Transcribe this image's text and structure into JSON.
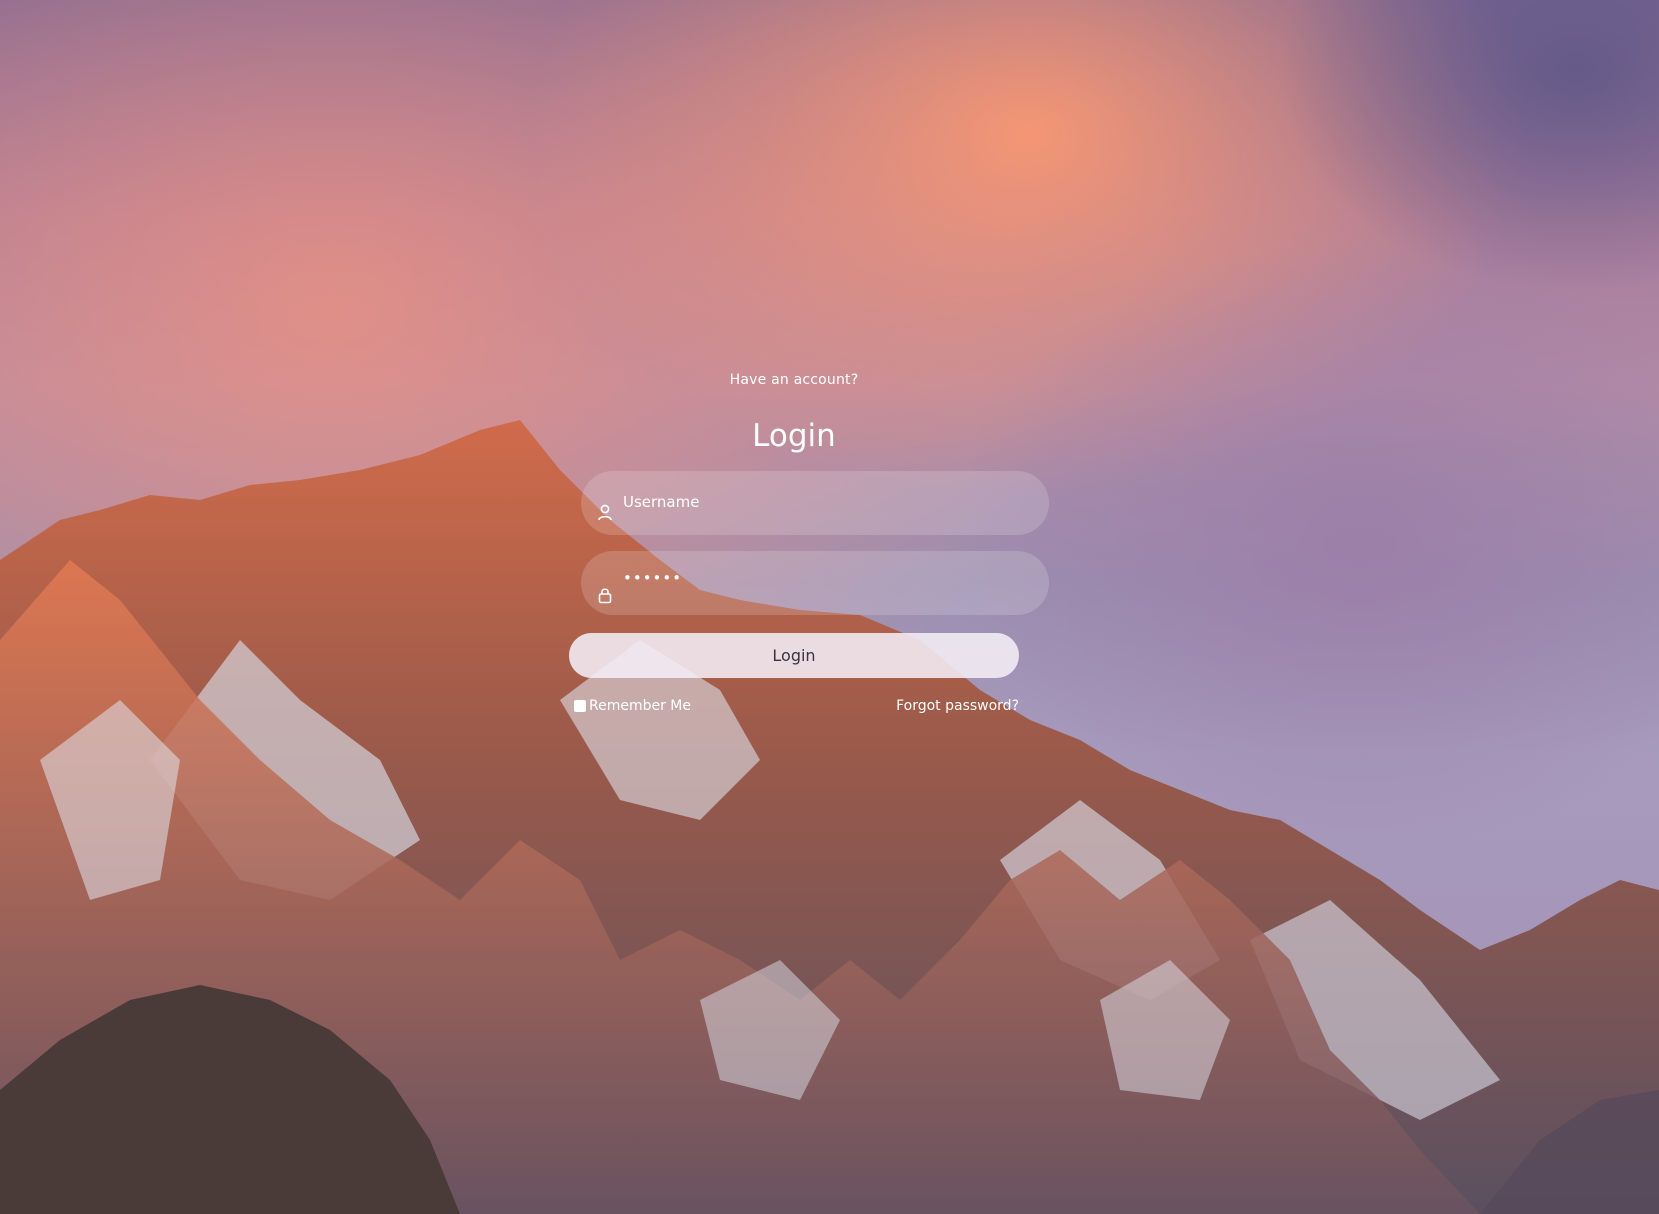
{
  "login": {
    "subtitle": "Have an account?",
    "title": "Login",
    "username_placeholder": "Username",
    "password_value": "••••••",
    "login_button": "Login",
    "remember_label": "Remember Me",
    "remember_checked": false,
    "forgot_link": "Forgot password?"
  },
  "icons": {
    "username": "user-icon",
    "password": "lock-icon"
  }
}
